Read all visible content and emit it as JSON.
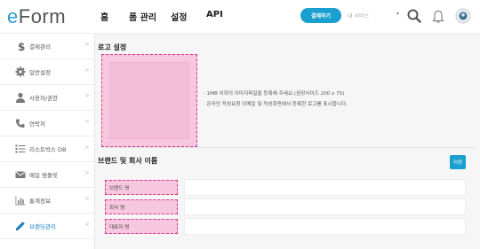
{
  "header": {
    "logo_e": "e",
    "logo_rest": "Form",
    "nav": [
      "홈",
      "폼 관리",
      "설정",
      "API"
    ],
    "cta_label": "결제하기",
    "my_service_label": "내 서비스",
    "my_service_caret": "▾",
    "icons": [
      "search-icon",
      "bell-icon",
      "profile-icon"
    ]
  },
  "sidebar": {
    "items": [
      {
        "label": "결제관리",
        "icon": "dollar-icon",
        "active": false
      },
      {
        "label": "일반설정",
        "icon": "gear-icon",
        "active": false
      },
      {
        "label": "사용자/권한",
        "icon": "user-icon",
        "active": false
      },
      {
        "label": "연락처",
        "icon": "phone-icon",
        "active": false
      },
      {
        "label": "리스트박스 DB",
        "icon": "list-icon",
        "active": false
      },
      {
        "label": "메일 템플릿",
        "icon": "envelope-icon",
        "active": false
      },
      {
        "label": "통계정보",
        "icon": "bar-chart-icon",
        "active": false
      },
      {
        "label": "브랜딩관리",
        "icon": "pencil-icon",
        "active": true
      }
    ],
    "chevron": ">"
  },
  "logo_section": {
    "title": "로고 설정",
    "info": [
      "· 1MB 이하의 이미지파일을 등록해 주세요.(권장사이즈 200 x 75)",
      "· 온라인 작성요청 이메일 및 작성화면에서 등록한 로고를 표시합니다."
    ]
  },
  "brand_section": {
    "title": "브랜드 및 회사 이름",
    "save_label": "저장",
    "fields": [
      {
        "label": "브랜드 명",
        "value": ""
      },
      {
        "label": "회사 명",
        "value": ""
      },
      {
        "label": "대표자 명",
        "value": ""
      }
    ]
  },
  "colors": {
    "accent": "#1aa0cf",
    "highlight_fill": "#f6c7de",
    "highlight_border": "#d9368a",
    "active_link": "#1a7fc0"
  }
}
